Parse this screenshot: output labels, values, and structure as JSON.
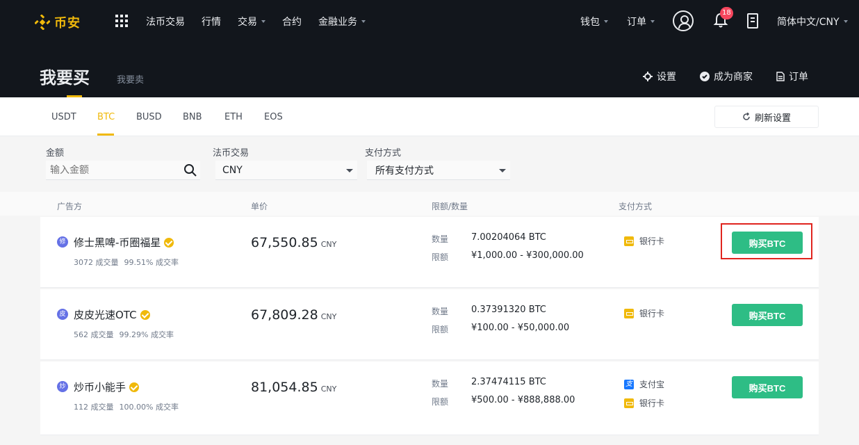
{
  "nav": {
    "logo_text": "币安",
    "items": [
      {
        "label": "法币交易",
        "dropdown": false
      },
      {
        "label": "行情",
        "dropdown": false
      },
      {
        "label": "交易",
        "dropdown": true
      },
      {
        "label": "合约",
        "dropdown": false
      },
      {
        "label": "金融业务",
        "dropdown": true
      }
    ],
    "wallet_label": "钱包",
    "orders_label": "订单",
    "notification_count": "18",
    "language": "简体中文/CNY"
  },
  "hero": {
    "buy_label": "我要买",
    "sell_label": "我要卖",
    "actions": [
      {
        "label": "设置",
        "icon": "gear-icon"
      },
      {
        "label": "成为商家",
        "icon": "verified-icon"
      },
      {
        "label": "订单",
        "icon": "document-icon"
      }
    ]
  },
  "tabs": {
    "items": [
      "USDT",
      "BTC",
      "BUSD",
      "BNB",
      "ETH",
      "EOS"
    ],
    "active": "BTC",
    "refresh_label": "刷新设置"
  },
  "filters": {
    "amount_label": "金额",
    "amount_placeholder": "输入金额",
    "fiat_label": "法币交易",
    "fiat_value": "CNY",
    "payment_label": "支付方式",
    "payment_value": "所有支付方式"
  },
  "table": {
    "headers": {
      "advertiser": "广告方",
      "price": "单价",
      "limits": "限额/数量",
      "payment": "支付方式"
    },
    "quantity_label": "数量",
    "limit_label": "限额",
    "currency": "CNY",
    "rows": [
      {
        "avatar": "修",
        "name": "修士黑啤-币圈福星",
        "trades": "3072 成交量",
        "rate": "99.51% 成交率",
        "price": "67,550.85",
        "quantity": "7.00204064 BTC",
        "limit": "¥1,000.00 - ¥300,000.00",
        "payments": [
          "银行卡"
        ],
        "button": "购买BTC"
      },
      {
        "avatar": "皮",
        "name": "皮皮光速OTC",
        "trades": "562 成交量",
        "rate": "99.29% 成交率",
        "price": "67,809.28",
        "quantity": "0.37391320 BTC",
        "limit": "¥100.00 - ¥50,000.00",
        "payments": [
          "银行卡"
        ],
        "button": "购买BTC"
      },
      {
        "avatar": "炒",
        "name": "炒币小能手",
        "trades": "112 成交量",
        "rate": "100.00% 成交率",
        "price": "81,054.85",
        "quantity": "2.37474115 BTC",
        "limit": "¥500.00 - ¥888,888.00",
        "payments": [
          "支付宝",
          "银行卡"
        ],
        "button": "购买BTC"
      }
    ]
  },
  "colors": {
    "nav_bg": "#12161c",
    "brand": "#f0b90b",
    "buy_green": "#2ebd85",
    "badge_red": "#f6465d",
    "highlight_red": "#e0241e"
  }
}
